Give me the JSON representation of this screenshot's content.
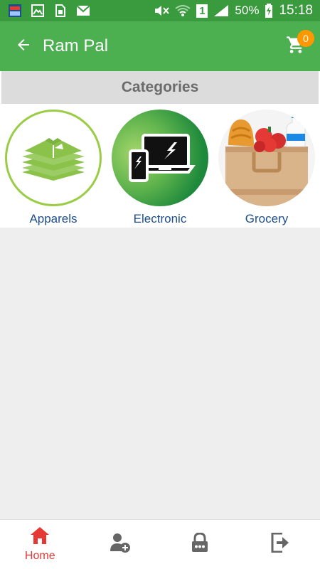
{
  "status_bar": {
    "battery": "50%",
    "time": "15:18",
    "sim_label": "1"
  },
  "app_bar": {
    "title": "Ram Pal",
    "cart_count": "0"
  },
  "categories": {
    "heading": "Categories",
    "items": [
      {
        "label": "Apparels",
        "icon": "shirts-icon"
      },
      {
        "label": "Electronic",
        "icon": "devices-icon"
      },
      {
        "label": "Grocery",
        "icon": "grocery-bag-icon"
      }
    ]
  },
  "bottom_nav": {
    "items": [
      {
        "label": "Home",
        "icon": "home-icon",
        "active": true
      },
      {
        "label": "",
        "icon": "add-user-icon"
      },
      {
        "label": "",
        "icon": "lock-icon"
      },
      {
        "label": "",
        "icon": "logout-icon"
      }
    ]
  },
  "colors": {
    "status_bar": "#3a9a3e",
    "app_bar": "#4caf50",
    "badge": "#ff9800",
    "active_nav": "#e53935",
    "category_label": "#1f4e8c"
  }
}
